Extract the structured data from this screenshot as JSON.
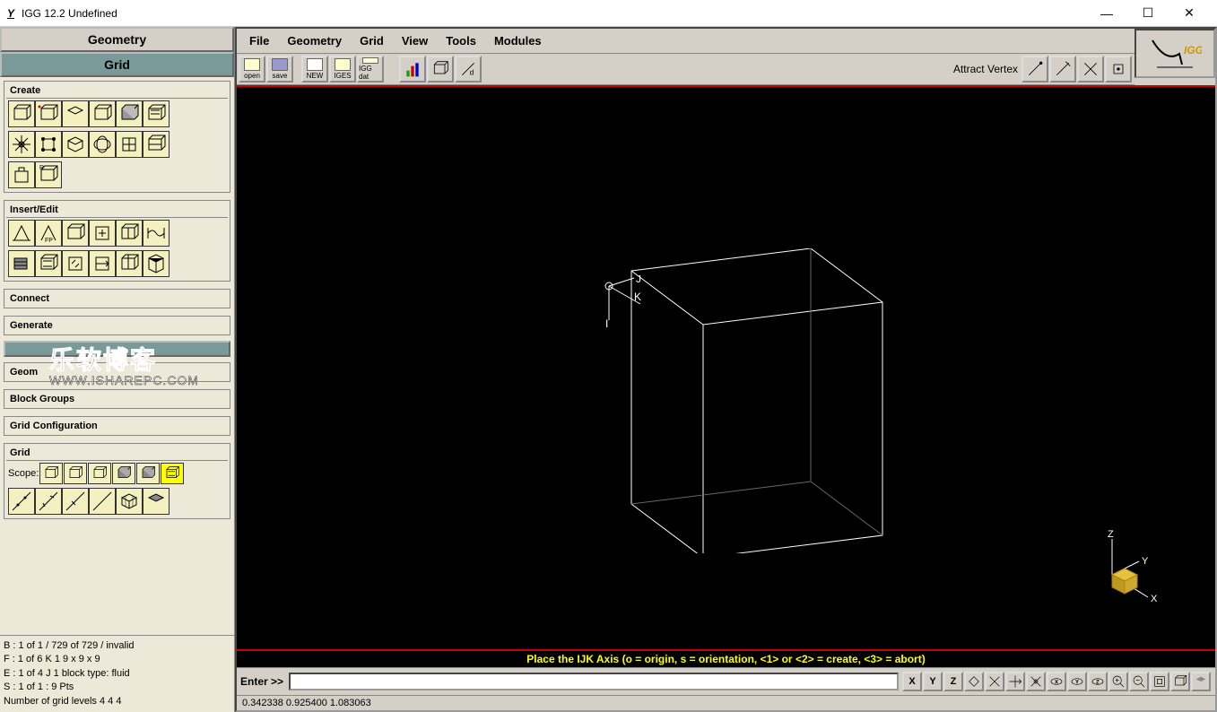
{
  "titlebar": {
    "app_icon": "Y",
    "title": "IGG 12.2     Undefined",
    "minimize": "—",
    "maximize": "☐",
    "close": "✕"
  },
  "left_panel": {
    "header_geometry": "Geometry",
    "header_grid": "Grid",
    "create_title": "Create",
    "insert_edit_title": "Insert/Edit",
    "connect_title": "Connect",
    "generate_title": "Generate",
    "geom_title": "Geom",
    "block_groups_title": "Block Groups",
    "grid_config_title": "Grid Configuration",
    "grid_title": "Grid",
    "scope_label": "Scope:"
  },
  "menubar": {
    "file": "File",
    "geometry": "Geometry",
    "grid": "Grid",
    "view": "View",
    "tools": "Tools",
    "modules": "Modules"
  },
  "toolbar": {
    "open": "open",
    "save": "save",
    "new": "NEW",
    "iges": "IGES",
    "iggdat": "IGG dat",
    "attract_vertex": "Attract Vertex"
  },
  "logo": {
    "text": "IGG"
  },
  "viewport": {
    "axis_i": "I",
    "axis_j": "J",
    "axis_k": "K",
    "world_x": "X",
    "world_y": "Y",
    "world_z": "Z",
    "hint": "Place the IJK Axis (o = origin, s = orientation, <1> or <2> = create, <3> = abort)"
  },
  "bottom": {
    "enter": "Enter >>",
    "coord_x": "X",
    "coord_y": "Y",
    "coord_z": "Z",
    "coords_readout": "0.342338   0.925400   1.083063"
  },
  "status_info": {
    "line1": "B :  1 of 1 / 729 of 729 / invalid",
    "line2": "F : 1 of 6   K   1     9 x 9 x 9",
    "line3": "E : 1 of 4   J   1    block type: fluid",
    "line4": "S : 1 of 1 : 9 Pts",
    "line5": "Number of grid levels 4 4 4"
  },
  "watermark": {
    "main": "乐软博客",
    "sub": "WWW.ISHAREPC.COM"
  }
}
